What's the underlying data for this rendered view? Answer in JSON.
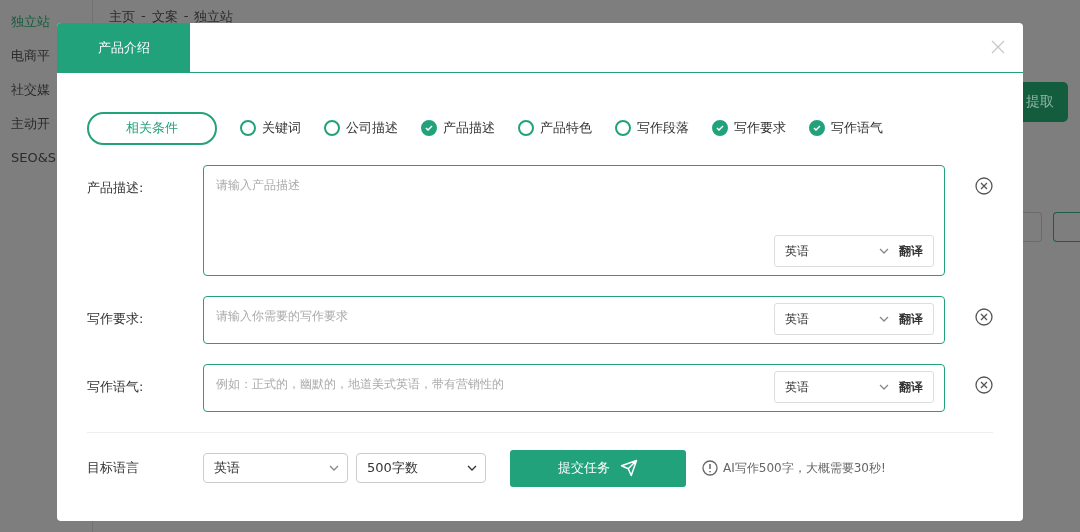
{
  "sidebar": {
    "items": [
      {
        "label": "独立站",
        "selected": true
      },
      {
        "label": "电商平",
        "selected": false
      },
      {
        "label": "社交媒",
        "selected": false
      },
      {
        "label": "主动开",
        "selected": false
      },
      {
        "label": "SEO&S",
        "selected": false
      }
    ]
  },
  "breadcrumb": {
    "items": [
      "主页",
      "文案",
      "独立站"
    ],
    "separator": "-"
  },
  "background": {
    "extract_button": "提取"
  },
  "dialog": {
    "tabs": [
      {
        "label": "产品介绍",
        "selected": true
      }
    ],
    "conditions_button": "相关条件",
    "conditions": [
      {
        "label": "关键词",
        "checked": false
      },
      {
        "label": "公司描述",
        "checked": false
      },
      {
        "label": "产品描述",
        "checked": true
      },
      {
        "label": "产品特色",
        "checked": false
      },
      {
        "label": "写作段落",
        "checked": false
      },
      {
        "label": "写作要求",
        "checked": true
      },
      {
        "label": "写作语气",
        "checked": true
      }
    ],
    "fields": [
      {
        "label": "产品描述:",
        "placeholder": "请输入产品描述",
        "multiline": true,
        "language": "英语",
        "translate": "翻译"
      },
      {
        "label": "写作要求:",
        "placeholder": "请输入你需要的写作要求",
        "multiline": false,
        "language": "英语",
        "translate": "翻译"
      },
      {
        "label": "写作语气:",
        "placeholder": "例如：正式的，幽默的，地道美式英语，带有营销性的",
        "multiline": false,
        "language": "英语",
        "translate": "翻译"
      }
    ],
    "footer": {
      "target_label": "目标语言",
      "language": "英语",
      "length": "500字数",
      "submit": "提交任务",
      "hint": "AI写作500字，大概需要30秒!"
    }
  }
}
